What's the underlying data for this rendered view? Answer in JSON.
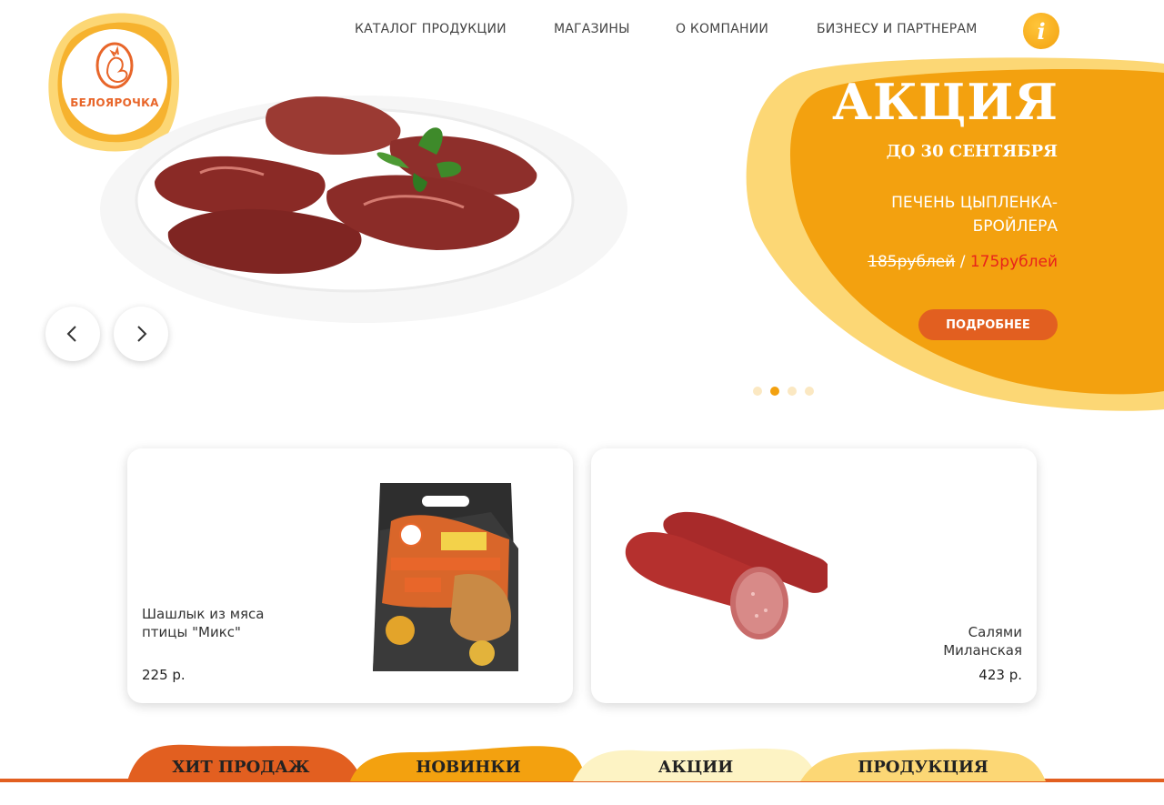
{
  "brand": {
    "name": "БЕЛОЯРОЧКА",
    "colors": {
      "orange": "#e25f20",
      "yellow": "#f3a10f",
      "light_yellow": "#fcd775",
      "cream": "#fdf3c4"
    }
  },
  "nav": {
    "items": [
      {
        "label": "КАТАЛОГ ПРОДУКЦИИ"
      },
      {
        "label": "МАГАЗИНЫ"
      },
      {
        "label": "О КОМПАНИИ"
      },
      {
        "label": "БИЗНЕСУ И ПАРТНЕРАМ"
      }
    ],
    "info_icon": "info-icon",
    "info_symbol": "i"
  },
  "hero": {
    "promo_title": "АКЦИЯ",
    "promo_date": "ДО 30 СЕНТЯБРЯ",
    "promo_product": "ПЕЧЕНЬ ЦЫПЛЕНКА-БРОЙЛЕРА",
    "price_old": "185рублей",
    "price_separator": " / ",
    "price_new": "175рублей",
    "button_label": "ПОДРОБНЕЕ",
    "prev_icon": "chevron-left-icon",
    "next_icon": "chevron-right-icon",
    "slides_count": 4,
    "active_slide": 2
  },
  "products": [
    {
      "name": "Шашлык из мяса птицы \"Микс\"",
      "price": "225 р."
    },
    {
      "name": "Салями Миланская",
      "price": "423 р."
    }
  ],
  "tabs": [
    {
      "label": "ХИТ ПРОДАЖ",
      "color": "#e25f20"
    },
    {
      "label": "НОВИНКИ",
      "color": "#f3a10f"
    },
    {
      "label": "АКЦИИ",
      "color": "#fdf3c4"
    },
    {
      "label": "ПРОДУКЦИЯ",
      "color": "#fcd775"
    }
  ]
}
